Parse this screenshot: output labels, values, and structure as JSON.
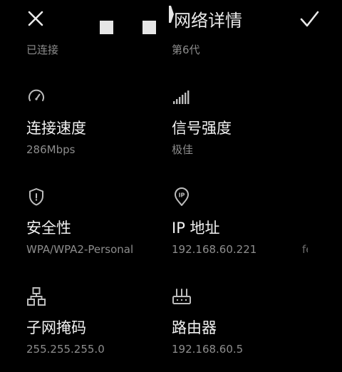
{
  "header": {
    "title": "网络详情",
    "close_icon": "close-icon",
    "confirm_icon": "checkmark-icon"
  },
  "partial_row": {
    "left_value": "已连接",
    "right_value": "第6代"
  },
  "details": [
    {
      "icon": "speedometer-icon",
      "label": "连接速度",
      "value": "286Mbps"
    },
    {
      "icon": "signal-strength-icon",
      "label": "信号强度",
      "value": "极佳"
    },
    {
      "icon": "shield-icon",
      "label": "安全性",
      "value": "WPA/WPA2-Personal"
    },
    {
      "icon": "ip-location-icon",
      "label": "IP 地址",
      "value": "192.168.60.221"
    },
    {
      "icon": "network-topology-icon",
      "label": "子网掩码",
      "value": "255.255.255.0"
    },
    {
      "icon": "router-icon",
      "label": "路由器",
      "value": "192.168.60.5"
    }
  ],
  "edge_fragment": "fe",
  "colors": {
    "background": "#000000",
    "primary_text": "#f2f2f2",
    "secondary_text": "#8d8d8d",
    "icon": "#bdbdbd"
  }
}
